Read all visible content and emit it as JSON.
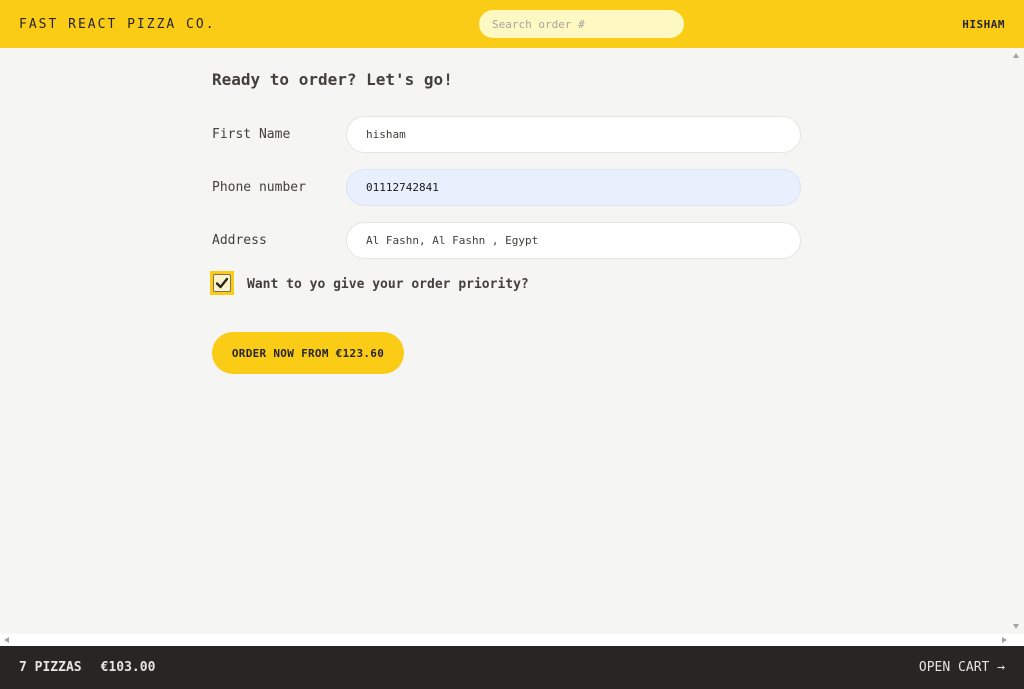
{
  "header": {
    "logo": "Fast React Pizza Co.",
    "search_placeholder": "Search order #",
    "username": "HISHAM"
  },
  "form": {
    "title": "Ready to order? Let's go!",
    "first_name": {
      "label": "First Name",
      "value": "hisham"
    },
    "phone": {
      "label": "Phone number",
      "value": "01112742841"
    },
    "address": {
      "label": "Address",
      "value": "Al Fashn, Al Fashn , Egypt"
    },
    "priority": {
      "label": "Want to yo give your order priority?",
      "checked": true
    },
    "submit_label": "Order now from €123.60"
  },
  "cart": {
    "pizzas": "7 pizzas",
    "total": "€103.00",
    "open_label": "Open cart →"
  },
  "colors": {
    "brand": "#facc15",
    "dark": "#292524"
  }
}
